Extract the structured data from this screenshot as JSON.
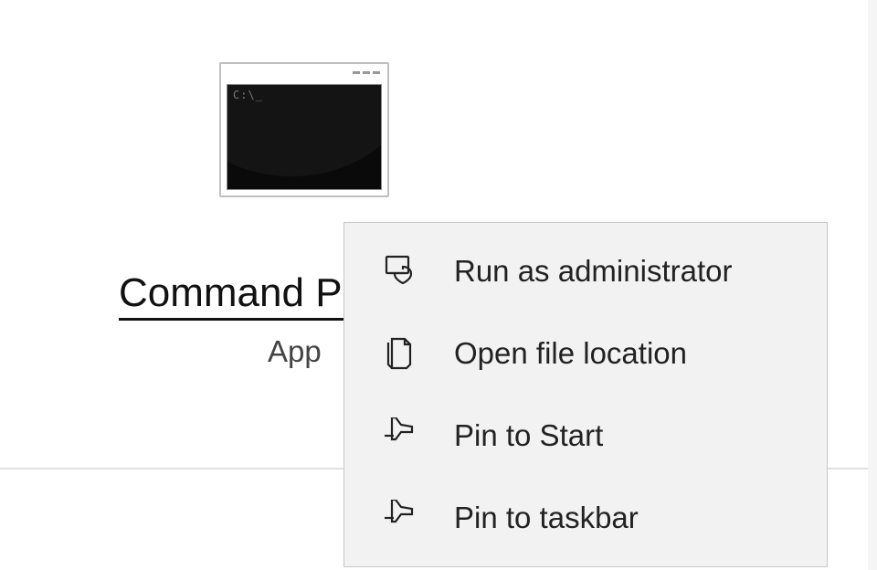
{
  "app": {
    "title": "Command Prompt",
    "type": "App",
    "prompt_glyph": "C:\\_"
  },
  "context_menu": {
    "items": [
      {
        "label": "Run as administrator",
        "icon": "run-as-admin-icon"
      },
      {
        "label": "Open file location",
        "icon": "open-file-location-icon"
      },
      {
        "label": "Pin to Start",
        "icon": "pin-icon"
      },
      {
        "label": "Pin to taskbar",
        "icon": "pin-icon"
      }
    ]
  }
}
